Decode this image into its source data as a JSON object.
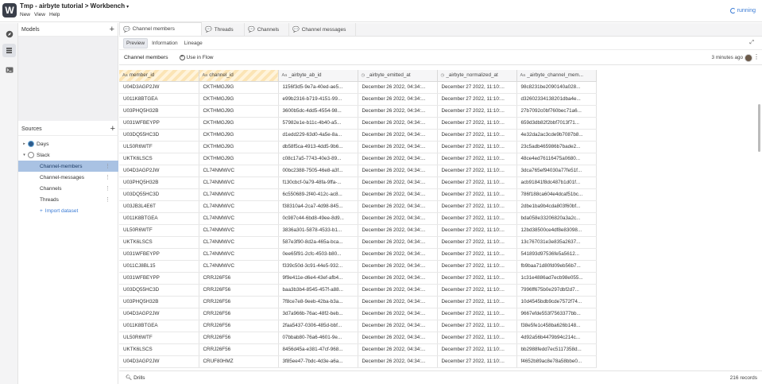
{
  "app": {
    "title": "Tmp - airbyte tutorial > Workbench",
    "title_caret": "▾",
    "logo": "W",
    "menu": [
      "New",
      "View",
      "Help"
    ],
    "status": "running"
  },
  "rail": {
    "icons": [
      "explore-icon",
      "layers-icon",
      "terminal-icon"
    ]
  },
  "models": {
    "header": "Models",
    "add": "+"
  },
  "sources": {
    "header": "Sources",
    "add": "+",
    "nodes": [
      {
        "label": "Days",
        "toggle": "▸"
      },
      {
        "label": "Slack",
        "toggle": "▾"
      }
    ],
    "slack_children": [
      "Channel-members",
      "Channel-messages",
      "Channels",
      "Threads"
    ],
    "selected": "Channel-members",
    "import": "Import dataset",
    "import_plus": "+"
  },
  "tabs": [
    "Channel members",
    "Threads",
    "Channels",
    "Channel messages"
  ],
  "subtabs": [
    "Preview",
    "Information",
    "Lineage"
  ],
  "toolbar": {
    "dataset_name": "Channel members",
    "use_in_flow": "Use in Flow",
    "updated": "3 minutes ago"
  },
  "table": {
    "columns": [
      "member_id",
      "channel_id",
      "_airbyte_ab_id",
      "_airbyte_emitted_at",
      "_airbyte_normalized_at",
      "_airbyte_channel_mem..."
    ],
    "column_type_icons": [
      "Aa",
      "Aa",
      "Aa",
      "◷",
      "◷",
      "Aa"
    ],
    "rows": [
      [
        "U04D3AGP2JW",
        "CKTHMGJ9G",
        "1156f3d5-9e7a-40ed-ae5...",
        "December 26 2022, 04:34:...",
        "December 27 2022, 11:10:...",
        "98c8231be2090140a028..."
      ],
      [
        "U011K8BTGEA",
        "CKTHMGJ9G",
        "e99b2316-b719-4151-99...",
        "December 26 2022, 04:34:...",
        "December 27 2022, 11:10:...",
        "d32602334138201dba4e..."
      ],
      [
        "U03PHQ5H32B",
        "CKTHMGJ9G",
        "3600b5dc-4dd5-4554-98...",
        "December 26 2022, 04:34:...",
        "December 27 2022, 11:10:...",
        "27b7092c0bf760bec71a6..."
      ],
      [
        "U031WFBEYPP",
        "CKTHMGJ9G",
        "57982e1e-b11c-4b40-a5...",
        "December 26 2022, 04:34:...",
        "December 27 2022, 11:10:...",
        "659d3db82f2bbf7013f71..."
      ],
      [
        "U03DQ55HC3D",
        "CKTHMGJ9G",
        "d1edd229-63d0-4a5e-8a...",
        "December 26 2022, 04:34:...",
        "December 27 2022, 11:10:...",
        "4e32da2ac3cde9b7087b8..."
      ],
      [
        "UL50R6WTF",
        "CKTHMGJ9G",
        "db58f5ca-4913-4dd5-9b6...",
        "December 26 2022, 04:34:...",
        "December 27 2022, 11:10:...",
        "23c5adb465986b7bade2..."
      ],
      [
        "UKTK6LSCS",
        "CKTHMGJ9G",
        "c08c17a5-7743-40e3-89...",
        "December 26 2022, 04:34:...",
        "December 27 2022, 11:10:...",
        "48ce4ed76116475a0680..."
      ],
      [
        "U04D3AGP2JW",
        "CL74NMWVC",
        "00bc2388-7505-46e8-a3f...",
        "December 26 2022, 04:34:...",
        "December 27 2022, 11:10:...",
        "3dca765ef94030a77fe51f..."
      ],
      [
        "U03PHQ5H32B",
        "CL74NMWVC",
        "f130cbcf-0a79-48fa-9ffa-...",
        "December 26 2022, 04:34:...",
        "December 27 2022, 11:10:...",
        "acb91841f8dc487b1d01f..."
      ],
      [
        "U03DQ55HC3D",
        "CL74NMWVC",
        "6c550689-2f40-412c-ac8...",
        "December 26 2022, 04:34:...",
        "December 27 2022, 11:10:...",
        "786f188ca604e4dcaf51bc..."
      ],
      [
        "U03JB3L4E6T",
        "CL74NMWVC",
        "f38310a4-2ca7-4d98-845...",
        "December 26 2022, 04:34:...",
        "December 27 2022, 11:10:...",
        "2dbe1ba9b4cda803f60bf..."
      ],
      [
        "U011K8BTGEA",
        "CL74NMWVC",
        "0c987c44-6bd8-49ee-8d9...",
        "December 26 2022, 04:34:...",
        "December 27 2022, 11:10:...",
        "bda058e33206820a3a2c..."
      ],
      [
        "UL50R6WTF",
        "CL74NMWVC",
        "3836a301-5878-4533-b1...",
        "December 26 2022, 04:34:...",
        "December 27 2022, 11:10:...",
        "12bd38500ce4df8e83098..."
      ],
      [
        "UKTK6LSCS",
        "CL74NMWVC",
        "587e3f90-8d2a-465a-bca...",
        "December 26 2022, 04:34:...",
        "December 27 2022, 11:10:...",
        "13c767031e3e835a2637..."
      ],
      [
        "U031WFBEYPP",
        "CL74NMWVC",
        "0ee65f91-2cfc-4503-b80...",
        "December 26 2022, 04:34:...",
        "December 27 2022, 11:10:...",
        "541893d97536fe5a5612..."
      ],
      [
        "U011CJ8BL15",
        "CL74NMWVC",
        "f339c50d-3c91-44e5-932...",
        "December 26 2022, 04:34:...",
        "December 27 2022, 11:10:...",
        "fb9baa71d80fd09eb56b7..."
      ],
      [
        "U031WFBEYPP",
        "CRRJ26F56",
        "9f9e411e-d6e4-43ef-afb4...",
        "December 26 2022, 04:34:...",
        "December 27 2022, 11:10:...",
        "1c31e4886ad7ecb98e055..."
      ],
      [
        "U03DQ55HC3D",
        "CRRJ26F56",
        "baa3b3b4-8545-457f-a88...",
        "December 26 2022, 04:34:...",
        "December 27 2022, 11:10:...",
        "7996ff675b0e297dbf2d7..."
      ],
      [
        "U03PHQ5H32B",
        "CRRJ26F56",
        "7f8ce7e8-9eeb-42ba-b3a...",
        "December 26 2022, 04:34:...",
        "December 27 2022, 11:10:...",
        "10d4545bdb9cde7572f74..."
      ],
      [
        "U04D3AGP2JW",
        "CRRJ26F56",
        "3d7a966b-76ac-48f2-beb...",
        "December 26 2022, 04:34:...",
        "December 27 2022, 11:10:...",
        "9667efde553f7563377bb..."
      ],
      [
        "U011K8BTGEA",
        "CRRJ26F56",
        "2faa5437-0306-485d-bbf...",
        "December 26 2022, 04:34:...",
        "December 27 2022, 11:10:...",
        "f38e5fe1c458ba626b148..."
      ],
      [
        "UL50R6WTF",
        "CRRJ26F56",
        "07bbab80-76a6-4601-9e...",
        "December 26 2022, 04:34:...",
        "December 27 2022, 11:10:...",
        "4d92a56b4479b94c214c..."
      ],
      [
        "UKTK6LSCS",
        "CRRJ26F56",
        "8456d45a-e381-47cf-968...",
        "December 26 2022, 04:34:...",
        "December 27 2022, 11:10:...",
        "bb2988fedd7ec5117358d..."
      ],
      [
        "U04D3AGP2JW",
        "CRUF80HMZ",
        "3f85ee47-7bdc-4d3e-a6a...",
        "December 26 2022, 04:34:...",
        "December 27 2022, 11:10:...",
        "f4652b89ac8e78a58bbe0..."
      ]
    ]
  },
  "footer": {
    "drills": "Drills",
    "records": "216 records"
  },
  "colors": {
    "accent": "#3a7bd5",
    "selected_row": "#a9c2e3",
    "key_header_stripe": "#fbe4b5"
  }
}
